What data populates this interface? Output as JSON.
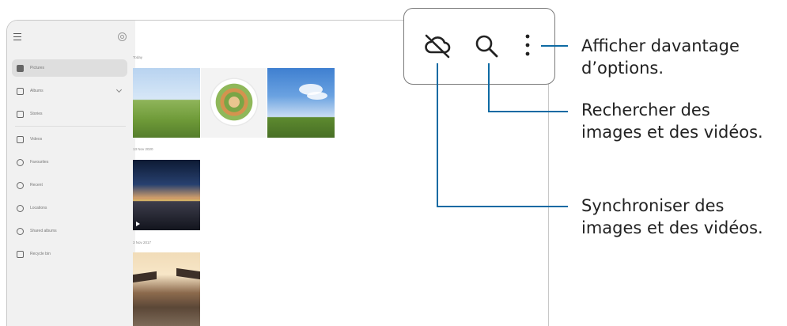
{
  "sidebar": {
    "items": [
      {
        "label": "Pictures",
        "icon": "image-icon",
        "active": true
      },
      {
        "label": "Albums",
        "icon": "album-icon",
        "active": false
      },
      {
        "label": "Stories",
        "icon": "stories-icon",
        "active": false
      },
      {
        "label": "Videos",
        "icon": "video-icon",
        "active": false
      },
      {
        "label": "Favourites",
        "icon": "heart-icon",
        "active": false
      },
      {
        "label": "Recent",
        "icon": "clock-icon",
        "active": false
      },
      {
        "label": "Locations",
        "icon": "location-icon",
        "active": false
      },
      {
        "label": "Shared albums",
        "icon": "shared-icon",
        "active": false
      },
      {
        "label": "Recycle bin",
        "icon": "trash-icon",
        "active": false
      }
    ]
  },
  "gallery": {
    "sections": [
      {
        "date": "Today"
      },
      {
        "date": "13 Nov 2020"
      },
      {
        "date": "3 Nov 2017"
      }
    ]
  },
  "toolbar": {
    "icons": [
      "cloud-off-icon",
      "search-icon",
      "more-options-icon"
    ]
  },
  "callouts": {
    "more": {
      "line1": "Afficher davantage",
      "line2": "d’options."
    },
    "search": {
      "line1": "Rechercher des",
      "line2": "images et des vidéos."
    },
    "sync": {
      "line1": "Synchroniser des",
      "line2": "images et des vidéos."
    }
  },
  "colors": {
    "leader": "#0e6aa3",
    "toolbar_border": "#7a7a7a",
    "sidebar_bg": "#f1f1f1"
  }
}
